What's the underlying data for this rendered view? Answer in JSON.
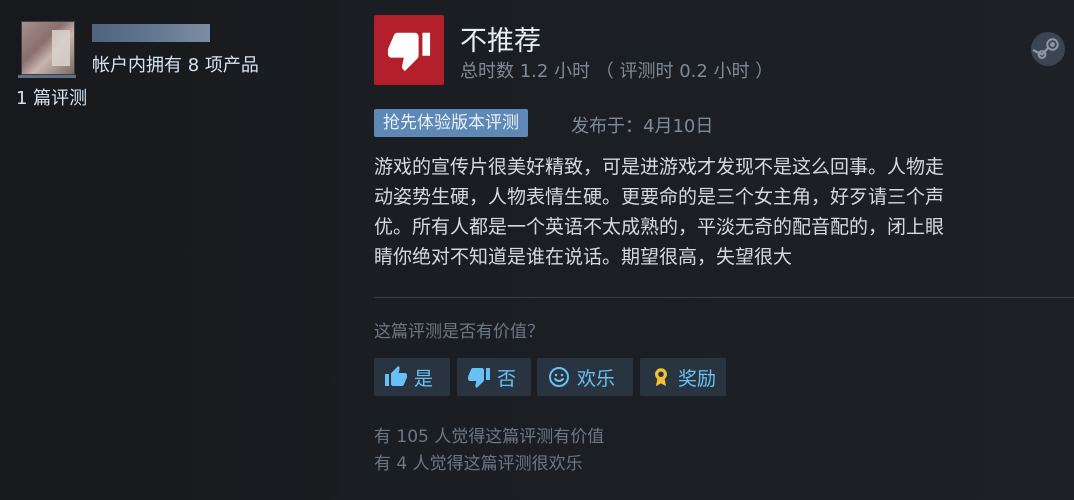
{
  "author": {
    "owned_products": "帐户内拥有 8 项产品",
    "review_count": "1 篇评测"
  },
  "review": {
    "verdict": "不推荐",
    "hours": "总时数 1.2 小时 （ 评测时 0.2 小时 ）",
    "early_access_badge": "抢先体验版本评测",
    "posted": "发布于：4月10日",
    "text_lines": [
      "游戏的宣传片很美好精致，可是进游戏才发现不是这么回事。人物走",
      "动姿势生硬，人物表情生硬。更要命的是三个女主角，好歹请三个声",
      "优。所有人都是一个英语不太成熟的，平淡无奇的配音配的，闭上眼",
      "睛你绝对不知道是谁在说话。期望很高，失望很大"
    ]
  },
  "feedback": {
    "question": "这篇评测是否有价值？",
    "yes_label": "是",
    "no_label": "否",
    "funny_label": "欢乐",
    "award_label": "奖励",
    "helpful_count_text": "有 105 人觉得这篇评测有价值",
    "funny_count_text": "有 4 人觉得这篇评测很欢乐"
  },
  "icons": {
    "verdict": "thumbs-down-icon",
    "platform": "steam-logo-icon",
    "yes": "thumbs-up-icon",
    "no": "thumbs-down-icon",
    "funny": "smiley-icon",
    "award": "award-medal-icon"
  },
  "colors": {
    "not_recommended": "#b3202b",
    "accent_link": "#67c1f5",
    "early_access_badge": "#5e89b6",
    "button_bg": "#2a3440",
    "award_gold": "#f1c232"
  }
}
